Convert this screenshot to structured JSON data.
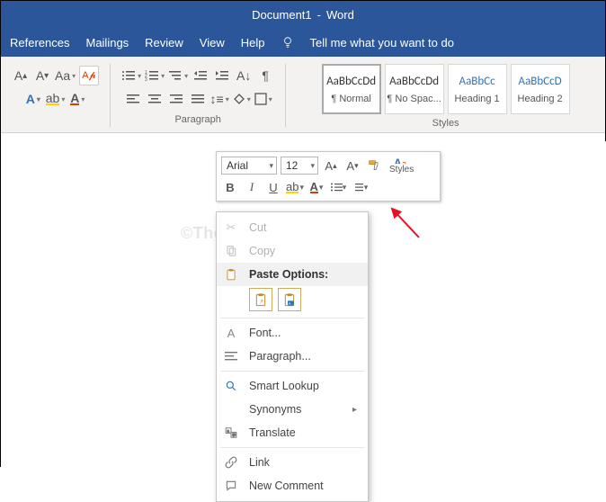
{
  "title": {
    "doc": "Document1",
    "app": "Word"
  },
  "menubar": {
    "items": [
      "References",
      "Mailings",
      "Review",
      "View",
      "Help"
    ],
    "tellme": "Tell me what you want to do"
  },
  "ribbon": {
    "paragraph_label": "Paragraph",
    "styles_label": "Styles"
  },
  "styles": [
    {
      "preview": "AaBbCcDd",
      "name": "¶ Normal",
      "selected": true,
      "class": ""
    },
    {
      "preview": "AaBbCcDd",
      "name": "¶ No Spac...",
      "selected": false,
      "class": ""
    },
    {
      "preview": "AaBbCc",
      "name": "Heading 1",
      "selected": false,
      "class": "h1"
    },
    {
      "preview": "AaBbCcD",
      "name": "Heading 2",
      "selected": false,
      "class": "h2"
    }
  ],
  "minitoolbar": {
    "font": "Arial",
    "size": "12",
    "styles_label": "Styles"
  },
  "contextmenu": {
    "cut": "Cut",
    "copy": "Copy",
    "paste_header": "Paste Options:",
    "font": "Font...",
    "paragraph": "Paragraph...",
    "smartlookup": "Smart Lookup",
    "synonyms": "Synonyms",
    "translate": "Translate",
    "link": "Link",
    "newcomment": "New Comment"
  },
  "watermark": "©TheGeekPage.com"
}
